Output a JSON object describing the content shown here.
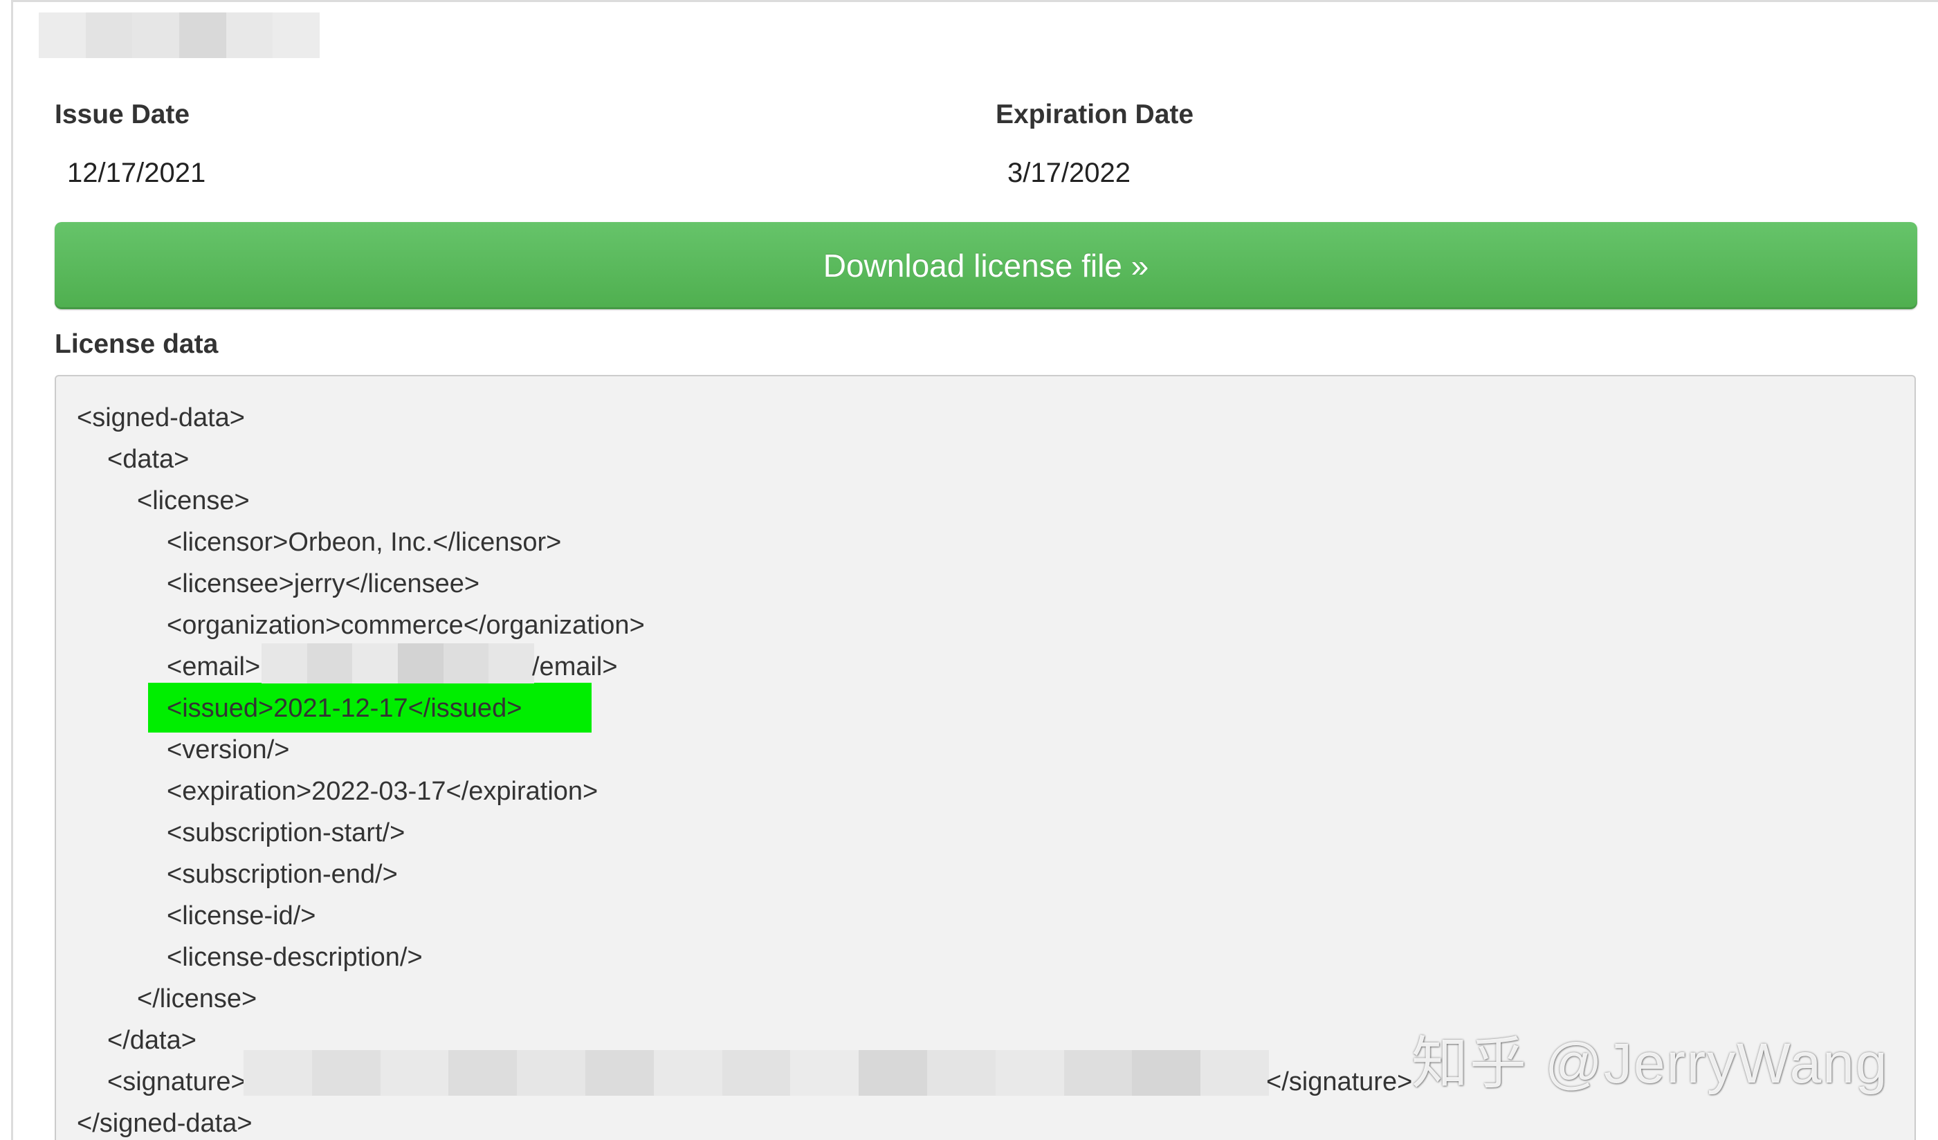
{
  "issue_date": {
    "label": "Issue Date",
    "value": "12/17/2021"
  },
  "expiration_date": {
    "label": "Expiration Date",
    "value": "3/17/2022"
  },
  "download_button": {
    "label": "Download license file »",
    "color": "#5cb85c"
  },
  "license_data": {
    "label": "License data",
    "highlight_color": "#00ee00",
    "lines": [
      "<signed-data>",
      "<data>",
      "<license>",
      "<licensor>Orbeon, Inc.</licensor>",
      "<licensee>jerry</licensee>",
      "<organization>commerce</organization>",
      "<email>",
      "/email>",
      "<issued>2021-12-17</issued>",
      "<version/>",
      "<expiration>2022-03-17</expiration>",
      "<subscription-start/>",
      "<subscription-end/>",
      "<license-id/>",
      "<license-description/>",
      "</license>",
      "</data>",
      "<signature>",
      "</signature>",
      "</signed-data>"
    ]
  },
  "watermark": {
    "text": "知乎 @JerryWang"
  }
}
